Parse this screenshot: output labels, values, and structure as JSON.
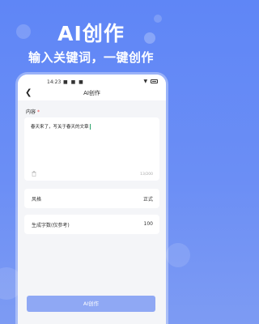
{
  "promo": {
    "title": "AI创作",
    "subtitle": "输入关键词，一键创作"
  },
  "status_bar": {
    "time": "14:23",
    "icons": "■ ■ ■"
  },
  "nav": {
    "back_icon": "back-arrow-icon",
    "title": "AI创作"
  },
  "content": {
    "label": "内容",
    "required_mark": "*",
    "value": "春天来了，写关于春天的文章",
    "char_count": "13/200",
    "delete_icon": "trash-icon"
  },
  "settings": {
    "style_label": "风格",
    "style_value": "正式",
    "word_count_label": "生成字数(仅参考)",
    "word_count_value": "100"
  },
  "submit": {
    "label": "AI创作"
  },
  "colors": {
    "background": "#6b8ef5",
    "button": "#8fa8f4",
    "required": "#e94848",
    "cursor": "#2ca36a"
  }
}
